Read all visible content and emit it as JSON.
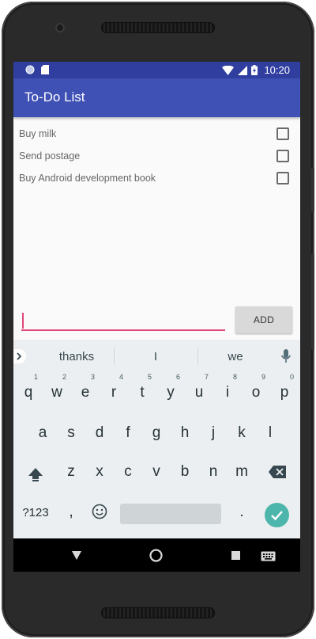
{
  "status_bar": {
    "time": "10:20",
    "icons": [
      "notification-dot-icon",
      "sd-card-icon",
      "wifi-icon",
      "signal-icon",
      "battery-icon"
    ]
  },
  "app": {
    "title": "To-Do List",
    "colors": {
      "primary": "#3f51b5",
      "primary_dark": "#303f9f",
      "accent": "#e0487a"
    }
  },
  "todos": [
    {
      "label": "Buy milk",
      "checked": false
    },
    {
      "label": "Send postage",
      "checked": false
    },
    {
      "label": "Buy Android development book",
      "checked": false
    }
  ],
  "input": {
    "value": "",
    "add_label": "ADD"
  },
  "keyboard": {
    "suggestions": [
      "thanks",
      "I",
      "we"
    ],
    "row1": [
      "q",
      "w",
      "e",
      "r",
      "t",
      "y",
      "u",
      "i",
      "o",
      "p"
    ],
    "row1_hints": [
      "1",
      "2",
      "3",
      "4",
      "5",
      "6",
      "7",
      "8",
      "9",
      "0"
    ],
    "row2": [
      "a",
      "s",
      "d",
      "f",
      "g",
      "h",
      "j",
      "k",
      "l"
    ],
    "row3": [
      "z",
      "x",
      "c",
      "v",
      "b",
      "n",
      "m"
    ],
    "symbols_label": "?123",
    "comma": ",",
    "period": "."
  },
  "nav_icons": [
    "back-icon",
    "home-icon",
    "recents-icon",
    "keyboard-switch-icon"
  ]
}
